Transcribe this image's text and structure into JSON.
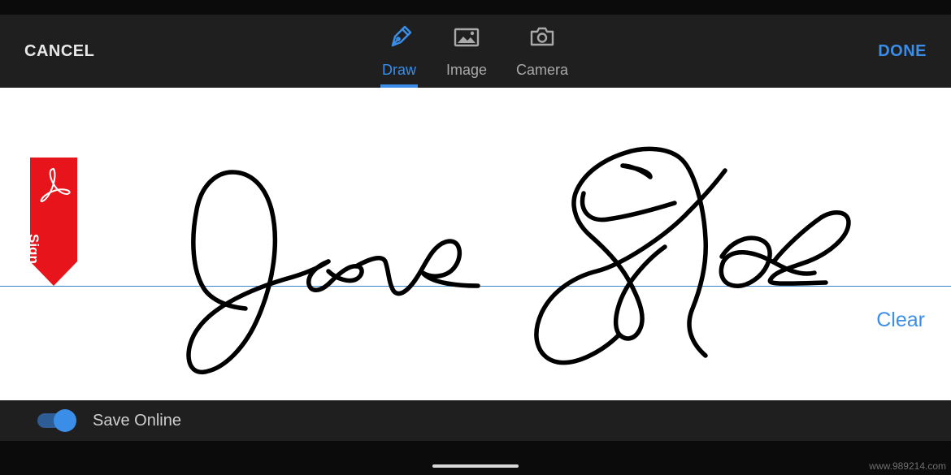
{
  "header": {
    "cancel_label": "CANCEL",
    "done_label": "DONE",
    "tabs": [
      {
        "label": "Draw",
        "icon": "pen-icon",
        "active": true
      },
      {
        "label": "Image",
        "icon": "image-icon",
        "active": false
      },
      {
        "label": "Camera",
        "icon": "camera-icon",
        "active": false
      }
    ]
  },
  "canvas": {
    "flag_label": "Sign",
    "flag_logo": "adobe-acrobat-logo",
    "clear_label": "Clear",
    "signature_text": "Jane Doe"
  },
  "footer": {
    "save_online_label": "Save Online",
    "save_online_enabled": true
  },
  "watermark": "www.989214.com",
  "colors": {
    "accent": "#3b8ee8",
    "flag_red": "#e8141b",
    "topbar_bg": "#1f1f1f"
  }
}
